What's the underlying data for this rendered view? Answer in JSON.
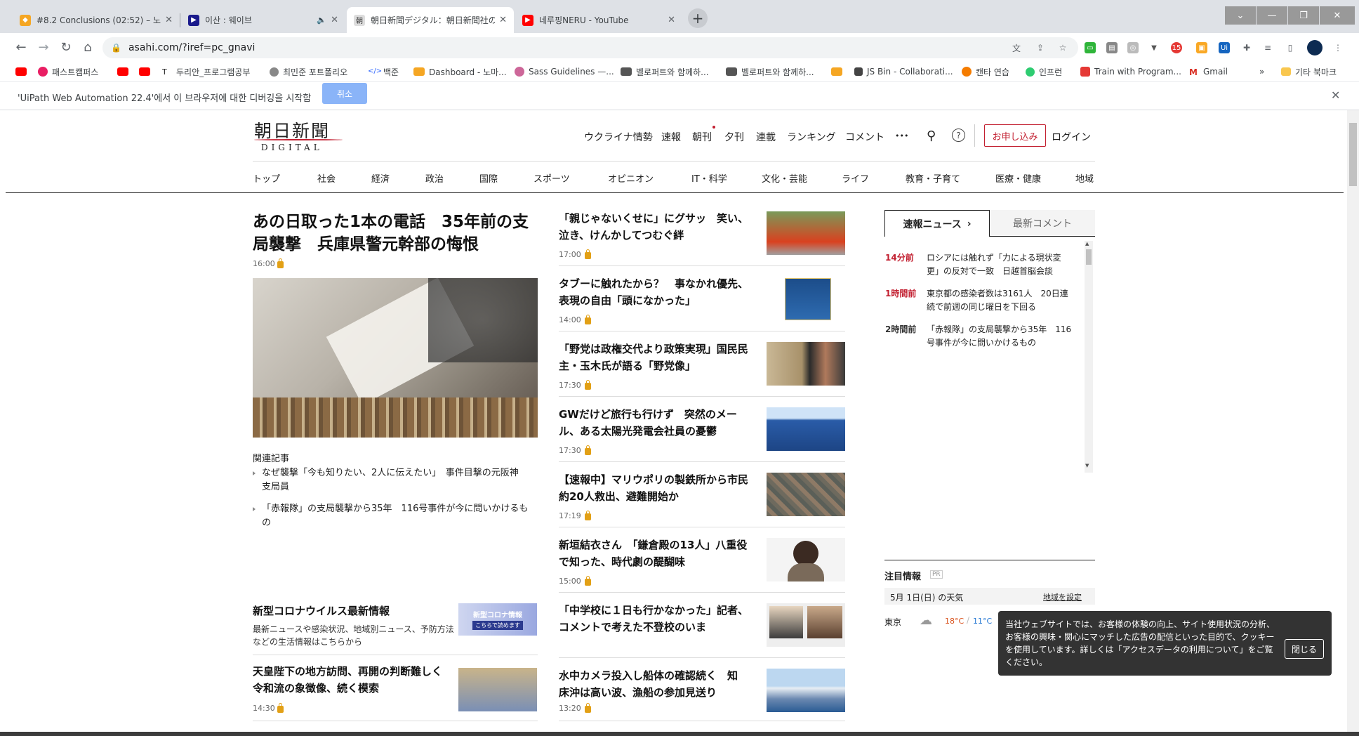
{
  "browser": {
    "tabs": [
      {
        "title": "#8.2 Conclusions (02:52) – 노마",
        "active": false
      },
      {
        "title": "이산 : 웨이브",
        "active": false
      },
      {
        "title": "朝日新聞デジタル：朝日新聞社の",
        "active": true
      },
      {
        "title": "네루핑NERU - YouTube",
        "active": false
      }
    ],
    "url": "asahi.com/?iref=pc_gnavi",
    "bookmarks": [
      "패스트캠퍼스",
      "두리안_프로그램공부",
      "최민준 포트폴리오",
      "백준",
      "Dashboard - 노마...",
      "Sass Guidelines —...",
      "벨로퍼트와 함께하...",
      "벨로퍼트와 함께하...",
      "JS Bin - Collaborati...",
      "캔타 연습",
      "인프런",
      "Train with Program...",
      "Gmail",
      "기타 북마크"
    ],
    "ext_badge": "15"
  },
  "infobar": {
    "message": "'UiPath Web Automation 22.4'에서 이 브라우저에 대한 디버깅을 시작함",
    "cancel": "취소"
  },
  "site": {
    "logo": "朝日新聞",
    "logo_sub": "DIGITAL",
    "gnav": [
      "ウクライナ情勢",
      "速報",
      "朝刊",
      "夕刊",
      "連載",
      "ランキング",
      "コメント",
      "•••"
    ],
    "signup": "お申し込み",
    "login": "ログイン",
    "categories": [
      "トップ",
      "社会",
      "経済",
      "政治",
      "国際",
      "スポーツ",
      "オピニオン",
      "IT・科学",
      "文化・芸能",
      "ライフ",
      "教育・子育て",
      "医療・健康",
      "地域"
    ]
  },
  "top_story": {
    "title_line1": "あの日取った1本の電話　35年前の支",
    "title_line2": "局襲撃　兵庫県警元幹部の悔恨",
    "time": "16:00",
    "related_heading": "関連記事",
    "related": [
      {
        "line1": "なぜ襲撃「今も知りたい、2人に伝えたい」　事件目撃の元阪神",
        "line2": "支局員"
      },
      {
        "line1": "「赤報隊」の支局襲撃から35年　116号事件が今に問いかけるも",
        "line2": "の"
      }
    ]
  },
  "left_lower": [
    {
      "title": "新型コロナウイルス最新情報",
      "desc1": "最新ニュースや感染状況、地域別ニュース、予防方法",
      "desc2": "などの生活情報はこちらから",
      "thumb_line1": "新型コロナ情報",
      "thumb_line2": "こちらで読めます"
    },
    {
      "title1": "天皇陛下の地方訪問、再開の判断難しく",
      "title2": "令和流の象徴像、続く模索",
      "time": "14:30"
    }
  ],
  "articles": [
    {
      "line1": "「親じゃないくせに」にグサッ　笑い、",
      "line2": "泣き、けんかしてつむぐ絆",
      "time": "17:00"
    },
    {
      "line1": "タブーに触れたから？　事なかれ優先、",
      "line2": "表現の自由「頭になかった」",
      "time": "14:00"
    },
    {
      "line1": "「野党は政権交代より政策実現」国民民",
      "line2": "主・玉木氏が語る「野党像」",
      "time": "17:30"
    },
    {
      "line1": "GWだけど旅行も行けず　突然のメー",
      "line2": "ル、ある太陽光発電会社員の憂鬱",
      "time": "17:30"
    },
    {
      "line1": "【速報中】マリウポリの製鉄所から市民",
      "line2": "約20人救出、避難開始か",
      "time": "17:19"
    },
    {
      "line1": "新垣結衣さん　「鎌倉殿の13人」八重役",
      "line2": "で知った、時代劇の醍醐味",
      "time": "15:00"
    },
    {
      "line1": "「中学校に１日も行かなかった」記者、",
      "line2": "コメントで考えた不登校のいま",
      "time": ""
    },
    {
      "line1": "水中カメラ投入し船体の確認続く　知",
      "line2": "床沖は高い波、漁船の参加見送り",
      "time": "13:20"
    }
  ],
  "news_panel": {
    "tab_active": "速報ニュース",
    "tab_other": "最新コメント",
    "items": [
      {
        "time": "14分前",
        "line1": "ロシアには触れず「力による現状変",
        "line2": "更」の反対で一致　日越首脳会談"
      },
      {
        "time": "1時間前",
        "line1": "東京都の感染者数は3161人　20日連",
        "line2": "続で前週の同じ曜日を下回る"
      },
      {
        "time": "2時間前",
        "line1": "「赤報隊」の支局襲撃から35年　116",
        "line2": "号事件が今に問いかけるもの"
      }
    ]
  },
  "notice": {
    "heading": "注目情報",
    "pr": "PR",
    "weather_date": "5月 1日(日) の天気",
    "region_link": "地域を設定",
    "city": "東京",
    "high": "18°C",
    "low": "11°C"
  },
  "cookie": {
    "text": "当社ウェブサイトでは、お客様の体験の向上、サイト使用状況の分析、お客様の興味・関心にマッチした広告の配信といった目的で、クッキーを使用しています。詳しくは「アクセスデータの利用について」をご覧ください。",
    "close": "閉じる"
  },
  "colors": {
    "brand_red": "#c21f30",
    "lock_gold": "#e2a016"
  }
}
